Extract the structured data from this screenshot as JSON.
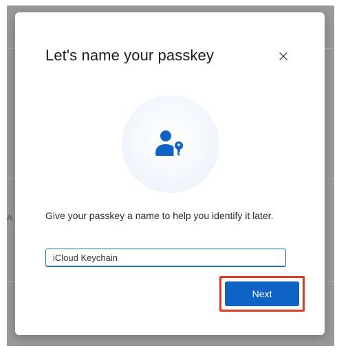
{
  "dialog": {
    "title": "Let's name your passkey",
    "close_icon": "close-icon",
    "hero_icon": "user-key-icon",
    "description": "Give your passkey a name to help you identify it later.",
    "name_input": {
      "value": "iCloud Keychain"
    },
    "next_label": "Next"
  },
  "background": {
    "fragment": "A"
  },
  "colors": {
    "primary": "#0f63c7",
    "highlight": "#e8361f",
    "overlay": "#9a9a9a"
  }
}
